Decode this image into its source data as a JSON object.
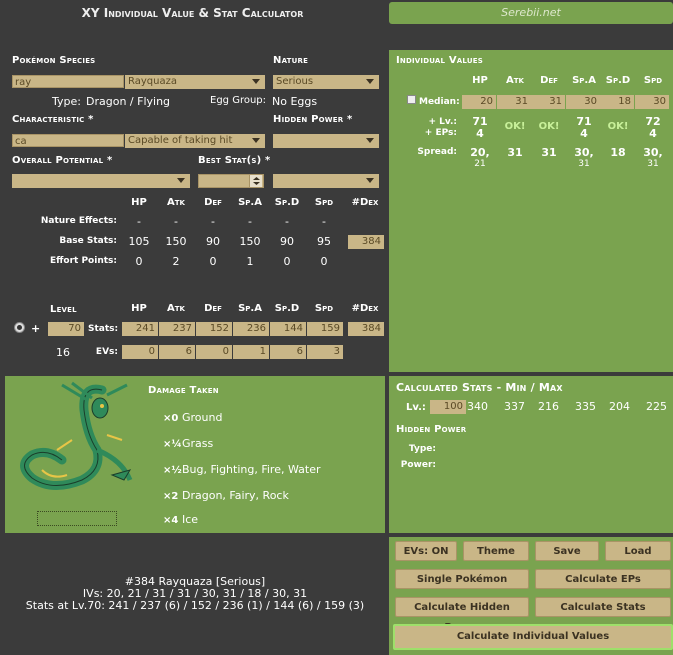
{
  "app": {
    "title": "XY Individual Value & Stat Calculator",
    "site": "Serebii.net"
  },
  "species": {
    "label": "Pokémon Species",
    "search_value": "ray",
    "selected": "Rayquaza",
    "type_label": "Type:",
    "type_value": "Dragon / Flying",
    "egg_label": "Egg Group:",
    "egg_value": "No Eggs"
  },
  "nature": {
    "label": "Nature",
    "selected": "Serious"
  },
  "characteristic": {
    "label": "Characteristic *",
    "search_value": "ca",
    "selected": "Capable of taking hit"
  },
  "hidden_power_sel": {
    "label": "Hidden Power *",
    "selected": ""
  },
  "overall_potential": {
    "label": "Overall Potential *",
    "selected": ""
  },
  "best_stats": {
    "label": "Best Stat(s) *",
    "spinner_value": "",
    "selected": ""
  },
  "stat_headers": [
    "HP",
    "Atk",
    "Def",
    "Sp.A",
    "Sp.D",
    "Spd",
    "#Dex"
  ],
  "nature_effects": {
    "label": "Nature Effects:",
    "values": [
      "-",
      "-",
      "-",
      "-",
      "-",
      "-"
    ]
  },
  "base_stats": {
    "label": "Base Stats:",
    "values": [
      "105",
      "150",
      "90",
      "150",
      "90",
      "95"
    ],
    "dex": "384"
  },
  "effort_points": {
    "label": "Effort Points:",
    "values": [
      "0",
      "2",
      "0",
      "1",
      "0",
      "0"
    ]
  },
  "level_section": {
    "level_label": "Level",
    "level_value": "70",
    "plus": "+",
    "stats_label": "Stats:",
    "stats": [
      "241",
      "237",
      "152",
      "236",
      "144",
      "159"
    ],
    "dex": "384",
    "ev_count": "16",
    "evs_label": "EVs:",
    "evs": [
      "0",
      "6",
      "0",
      "1",
      "6",
      "3"
    ]
  },
  "iv_panel": {
    "title": "Individual Values",
    "headers": [
      "HP",
      "Atk",
      "Def",
      "Sp.A",
      "Sp.D",
      "Spd"
    ],
    "median_label": "Median:",
    "median": [
      "20",
      "31",
      "31",
      "30",
      "18",
      "30"
    ],
    "lv_label": "+ Lv.:",
    "eps_label": "+ EPs:",
    "lv_vals": [
      "71",
      "OK!",
      "OK!",
      "71",
      "OK!",
      "72"
    ],
    "ep_vals": [
      "4",
      "",
      "",
      "4",
      "",
      "4"
    ],
    "spread_label": "Spread:",
    "spread_top": [
      "20,",
      "31",
      "31",
      "30,",
      "18",
      "30,"
    ],
    "spread_bottom": [
      "21",
      "",
      "",
      "31",
      "",
      "31"
    ]
  },
  "damage": {
    "title": "Damage Taken",
    "rows": [
      {
        "mult": "×0",
        "types": "Ground"
      },
      {
        "mult": "×¼",
        "types": "Grass"
      },
      {
        "mult": "×½",
        "types": "Bug, Fighting, Fire, Water"
      },
      {
        "mult": "×2",
        "types": "Dragon, Fairy, Rock"
      },
      {
        "mult": "×4",
        "types": "Ice"
      }
    ]
  },
  "calc_stats": {
    "title": "Calculated Stats - Min / Max",
    "lv_label": "Lv.:",
    "lv_value": "100",
    "values": [
      "340",
      "337",
      "216",
      "335",
      "204",
      "225"
    ]
  },
  "hp_panel": {
    "title": "Hidden Power",
    "type_label": "Type:",
    "power_label": "Power:"
  },
  "summary": {
    "line1": "#384 Rayquaza [Serious]",
    "line2": "IVs: 20, 21 / 31 / 31 / 30, 31 / 18 / 30, 31",
    "line3": "Stats at Lv.70: 241 / 237 (6) / 152 / 236 (1) / 144 (6) / 159 (3)"
  },
  "buttons": {
    "evs_on": "EVs: ON",
    "theme": "Theme",
    "save": "Save",
    "load": "Load",
    "single": "Single Pokémon",
    "calc_eps": "Calculate EPs",
    "calc_hp": "Calculate Hidden Power",
    "calc_stats": "Calculate Stats",
    "calc_ivs": "Calculate Individual Values"
  },
  "colors": {
    "panel_green": "#7aa34f",
    "field_tan": "#c9b687",
    "background": "#3b3b3b",
    "ok_green": "#c8f09a"
  }
}
